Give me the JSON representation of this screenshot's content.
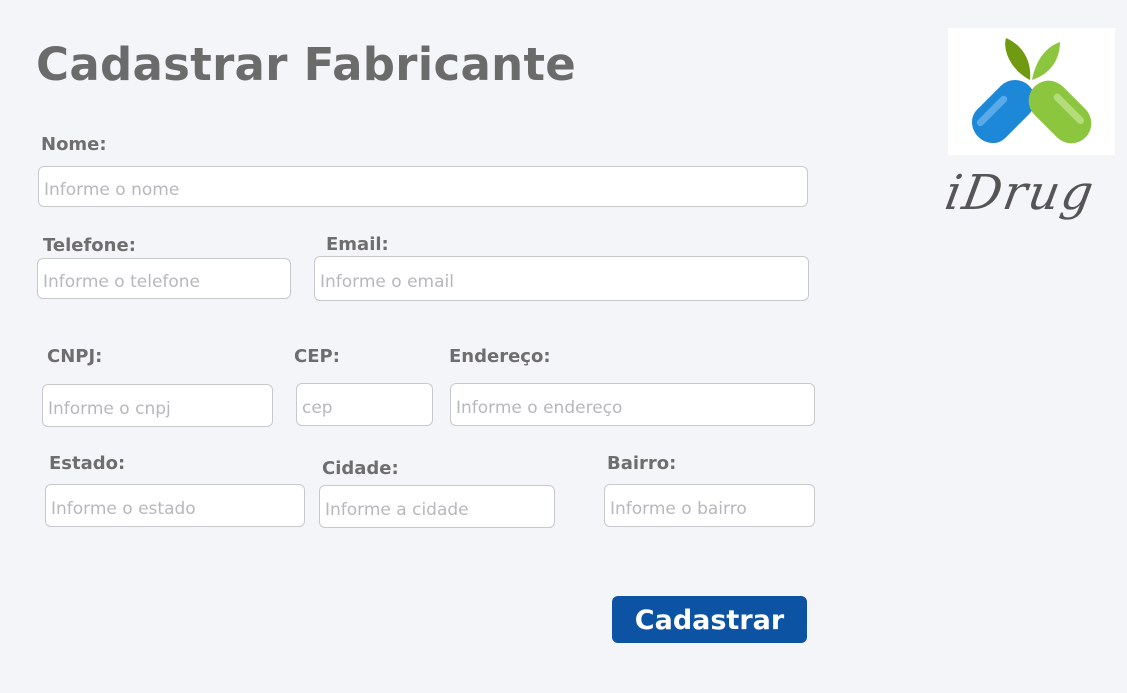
{
  "page": {
    "title": "Cadastrar Fabricante"
  },
  "form": {
    "nome": {
      "label": "Nome:",
      "placeholder": "Informe o nome"
    },
    "telefone": {
      "label": "Telefone:",
      "placeholder": "Informe o telefone"
    },
    "email": {
      "label": "Email:",
      "placeholder": "Informe o email"
    },
    "cnpj": {
      "label": "CNPJ:",
      "placeholder": "Informe o cnpj"
    },
    "cep": {
      "label": "CEP:",
      "placeholder": "cep"
    },
    "endereco": {
      "label": "Endereço:",
      "placeholder": "Informe o endereço"
    },
    "estado": {
      "label": "Estado:",
      "placeholder": "Informe o estado"
    },
    "cidade": {
      "label": "Cidade:",
      "placeholder": "Informe a cidade"
    },
    "bairro": {
      "label": "Bairro:",
      "placeholder": "Informe o bairro"
    },
    "submit_label": "Cadastrar"
  },
  "brand": {
    "name": "iDrug",
    "logo_icon": "capsule-leaves-icon"
  },
  "colors": {
    "background": "#f4f5f9",
    "accent": "#0c53a4",
    "capsule_blue": "#1e88d8",
    "capsule_green": "#8cc63f",
    "leaf_dark": "#6f9a12"
  }
}
